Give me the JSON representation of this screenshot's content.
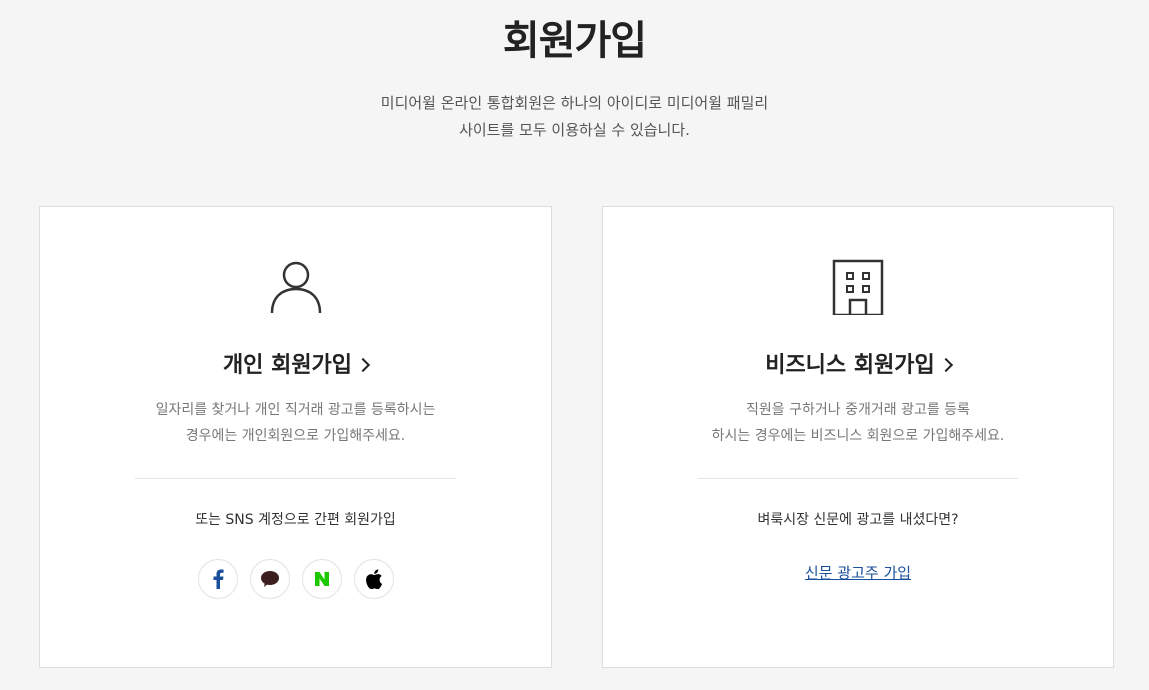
{
  "header": {
    "title": "회원가입",
    "subtitle_line1": "미디어윌 온라인 통합회원은 하나의 아이디로 미디어윌 패밀리",
    "subtitle_line2": "사이트를 모두 이용하실 수 있습니다."
  },
  "personal": {
    "icon": "person-icon",
    "title": "개인 회원가입",
    "desc_line1": "일자리를 찾거나 개인 직거래 광고를 등록하시는",
    "desc_line2": "경우에는 개인회원으로 가입해주세요.",
    "sns_label": "또는 SNS 계정으로 간편 회원가입",
    "sns": [
      {
        "icon": "facebook-icon",
        "color": "#1877f2"
      },
      {
        "icon": "kakao-icon",
        "color": "#3c1e1e"
      },
      {
        "icon": "naver-icon",
        "color": "#03c75a"
      },
      {
        "icon": "apple-icon",
        "color": "#000000"
      }
    ]
  },
  "business": {
    "icon": "building-icon",
    "title": "비즈니스 회원가입",
    "desc_line1": "직원을 구하거나 중개거래 광고를 등록",
    "desc_line2": "하시는 경우에는 비즈니스 회원으로 가입해주세요.",
    "question": "벼룩시장 신문에 광고를 내셨다면?",
    "link_label": "신문 광고주 가입"
  }
}
